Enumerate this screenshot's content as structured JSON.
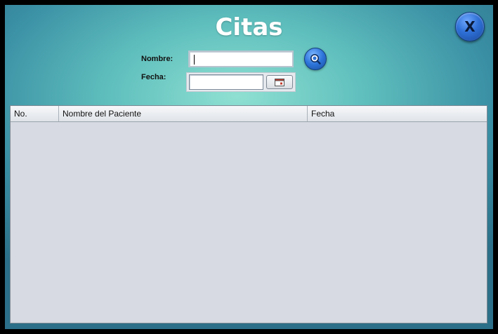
{
  "window": {
    "title": "Citas",
    "close_label": "X"
  },
  "form": {
    "nombre_label": "Nombre:",
    "nombre_value": "",
    "fecha_label": "Fecha:",
    "fecha_value": ""
  },
  "table": {
    "columns": [
      "No.",
      "Nombre del Paciente",
      "Fecha"
    ],
    "rows": []
  },
  "icons": {
    "search": "search-icon",
    "calendar": "calendar-icon",
    "close": "close-icon"
  }
}
